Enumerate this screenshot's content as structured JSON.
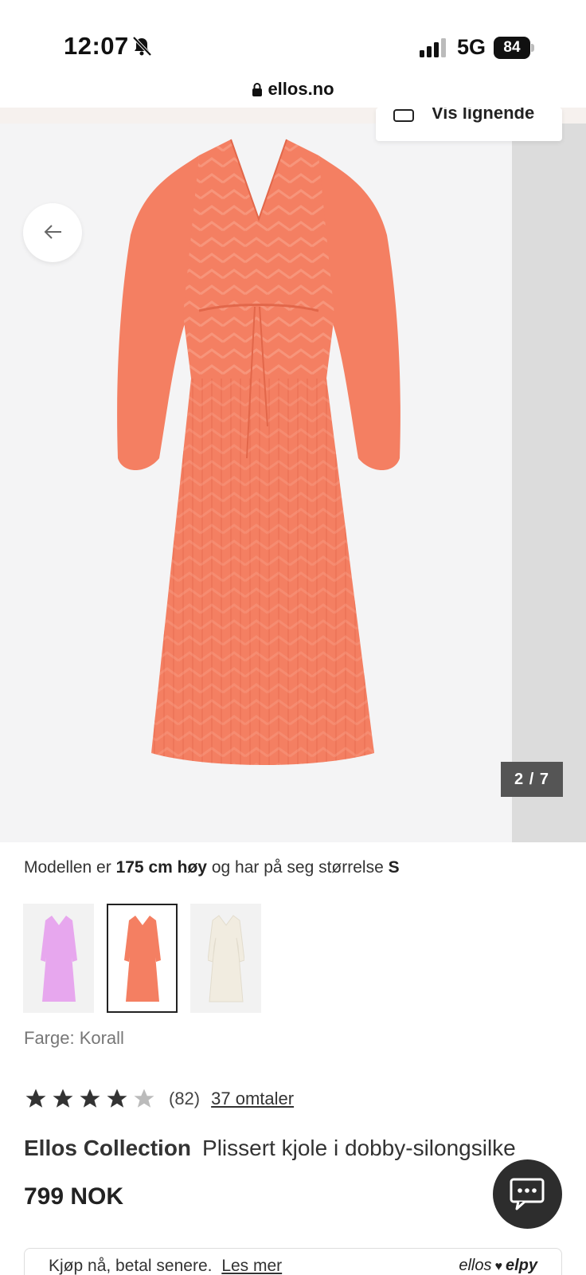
{
  "status_bar": {
    "time": "12:07",
    "network": "5G",
    "battery": "84",
    "icons": [
      "bell-muted-icon",
      "signal-icon",
      "battery-icon"
    ]
  },
  "browser": {
    "url": "ellos.no",
    "icons": [
      "lock-icon"
    ]
  },
  "gallery": {
    "similar_label": "Vis lignende",
    "counter": "2 / 7",
    "colors": {
      "dress": "#f47f62",
      "background": "#f4f4f5"
    },
    "icons": [
      "back-arrow-icon",
      "similar-icon"
    ]
  },
  "model_info": {
    "prefix": "Modellen er",
    "height": "175 cm høy",
    "middle": "og har på seg størrelse",
    "size": "S"
  },
  "swatches": [
    {
      "name": "lilac",
      "color": "#e7a7ee"
    },
    {
      "name": "coral",
      "color": "#f47f62",
      "selected": true
    },
    {
      "name": "ivory",
      "color": "#f1ece0"
    }
  ],
  "color_label": "Farge: Korall",
  "rating": {
    "stars": 4,
    "max": 5,
    "count": "(82)",
    "reviews_link": "37 omtaler"
  },
  "product": {
    "brand": "Ellos Collection",
    "name": "Plissert kjole i dobby-silongsilke",
    "price": "799 NOK"
  },
  "banner": {
    "text": "Kjøp nå, betal senere.",
    "link": "Les mer",
    "logo_left": "ellos",
    "logo_right": "elpy"
  },
  "chat": {
    "icon": "chat-icon"
  }
}
